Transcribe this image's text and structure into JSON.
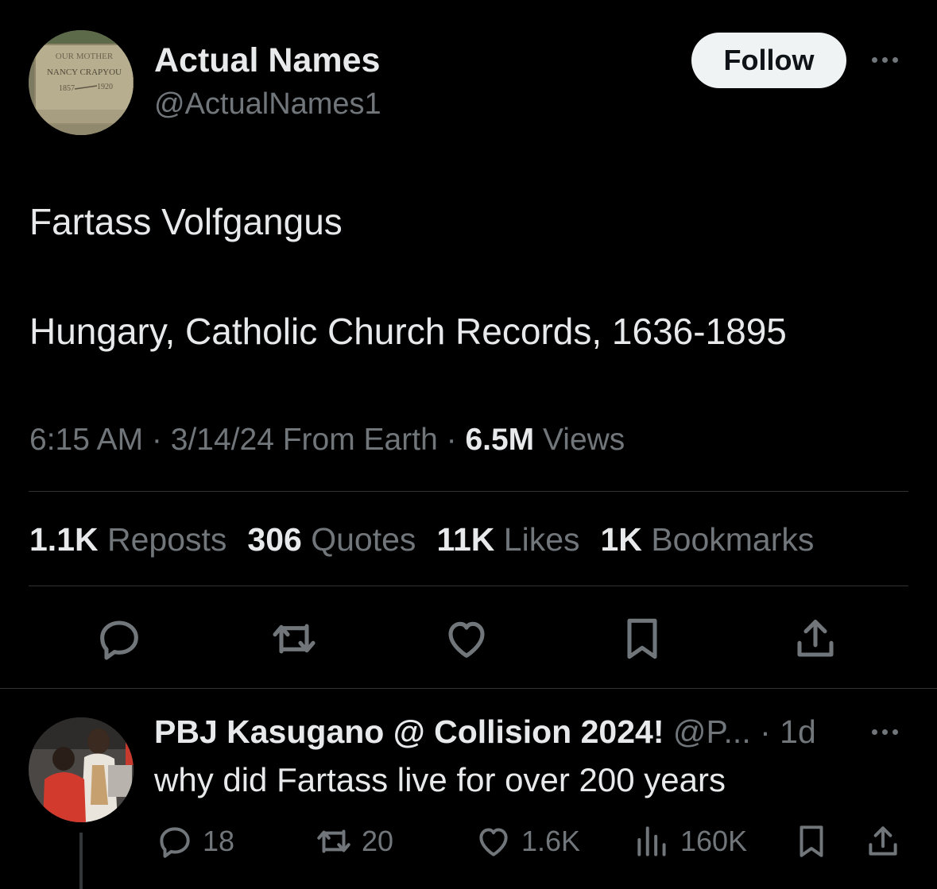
{
  "author": {
    "name": "Actual Names",
    "handle": "@ActualNames1",
    "avatar_text": {
      "line1": "OUR MOTHER",
      "line2": "NANCY CRAPYOU",
      "line3": "1857",
      "line4": "1920"
    }
  },
  "follow_label": "Follow",
  "tweet": {
    "line1": "Fartass Volfgangus",
    "line2": "Hungary, Catholic Church Records, 1636-1895"
  },
  "meta": {
    "time": "6:15 AM",
    "sep1": " · ",
    "date": "3/14/24 From Earth",
    "sep2": " · ",
    "views_count": "6.5M",
    "views_label": " Views"
  },
  "stats": [
    {
      "count": "1.1K",
      "label": " Reposts"
    },
    {
      "count": "306",
      "label": " Quotes"
    },
    {
      "count": "11K",
      "label": " Likes"
    },
    {
      "count": "1K",
      "label": " Bookmarks"
    }
  ],
  "icons": {
    "reply": "reply-icon",
    "repost": "repost-icon",
    "like": "heart-icon",
    "bookmark": "bookmark-icon",
    "share": "share-icon",
    "views": "views-icon"
  },
  "colors": {
    "background": "#000000",
    "text": "#e7e9ea",
    "muted": "#71767b",
    "divider": "#2f3336",
    "follow_bg": "#eff3f4"
  },
  "reply": {
    "name": "PBJ Kasugano @ Collision 2024!",
    "handle": " @P... · 1d",
    "text": "why did Fartass live for over 200 years",
    "replies": "18",
    "reposts": "20",
    "likes": "1.6K",
    "views": "160K"
  }
}
